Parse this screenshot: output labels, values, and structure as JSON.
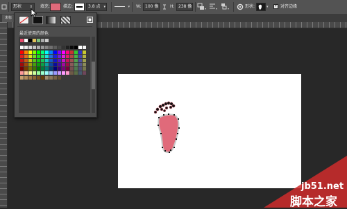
{
  "toolbar": {
    "shape_mode": "形状",
    "fill_label": "填充:",
    "fill_color": "#e06a7a",
    "stroke_label": "描边:",
    "stroke_width": "3.8 点",
    "width_label": "W:",
    "width_value": "100 像",
    "height_label": "H:",
    "height_value": "238 像",
    "shape_label": "形状:",
    "align_edges_label": "对齐边缘",
    "align_edges_checked": true
  },
  "document": {
    "tab_label": "未标"
  },
  "fill_panel": {
    "recent_colors_label": "最近使用的颜色",
    "recent_colors": [
      "#e64b6b",
      "#ffffff",
      "#000000",
      "#e0c15a",
      "#7ec07e",
      "#aaaaaa",
      "#cccccc"
    ],
    "gray_ramp": [
      "#ffffff",
      "#ebebeb",
      "#d6d6d6",
      "#c2c2c2",
      "#adadad",
      "#999999",
      "#858585",
      "#707070",
      "#5c5c5c",
      "#474747",
      "#333333",
      "#1f1f1f",
      "#0a0a0a",
      "#000000",
      "#ffffff",
      "#f2f2f2"
    ],
    "color_swatches": [
      "#ff0000",
      "#ff8000",
      "#ffff00",
      "#80ff00",
      "#00ff00",
      "#00ff80",
      "#00ffff",
      "#0080ff",
      "#0000ff",
      "#8000ff",
      "#ff00ff",
      "#ff0080",
      "#c83232",
      "#32c832",
      "#3232c8",
      "#c8c832",
      "#e01e1e",
      "#e06e1e",
      "#e0e01e",
      "#6ee01e",
      "#1ee01e",
      "#1ee06e",
      "#1ee0e0",
      "#1e6ee0",
      "#1e1ee0",
      "#6e1ee0",
      "#e01ee0",
      "#e01e6e",
      "#b44646",
      "#46b446",
      "#4646b4",
      "#b4b446",
      "#c81414",
      "#c85a14",
      "#c8c814",
      "#5ac814",
      "#14c814",
      "#14c85a",
      "#14c8c8",
      "#145ac8",
      "#1414c8",
      "#5a14c8",
      "#c814c8",
      "#c8145a",
      "#a05050",
      "#50a050",
      "#5050a0",
      "#a0a050",
      "#a00a0a",
      "#a0460a",
      "#a0a00a",
      "#46a00a",
      "#0aa00a",
      "#0aa046",
      "#0aa0a0",
      "#0a46a0",
      "#0a0aa0",
      "#460aa0",
      "#a00aa0",
      "#a00a46",
      "#8c5a5a",
      "#5a8c5a",
      "#5a5a8c",
      "#8c8c5a",
      "#780000",
      "#783c00",
      "#787800",
      "#3c7800",
      "#007800",
      "#00783c",
      "#007878",
      "#003c78",
      "#000078",
      "#3c0078",
      "#780078",
      "#78003c",
      "#785050",
      "#507850",
      "#505078",
      "#787850",
      "#ff9999",
      "#ffcc99",
      "#ffff99",
      "#ccff99",
      "#99ff99",
      "#99ffcc",
      "#99ffff",
      "#99ccff",
      "#9999ff",
      "#cc99ff",
      "#ff99ff",
      "#ff99cc",
      "#6e5a46",
      "#5a6e46",
      "#465a6e",
      "#6e465a"
    ],
    "brown_swatches": [
      "#c8a06e",
      "#b48c5a",
      "#a07846",
      "#8c6432",
      "#78501e",
      "#643c0a",
      "#a08c6e",
      "#8c785a",
      "#786446",
      "#645032"
    ]
  },
  "footprint": {
    "fill": "#e06a7a",
    "stroke": "#c8c8c8"
  },
  "watermark": {
    "line1": "jb51.net",
    "line2": "脚本之家"
  }
}
